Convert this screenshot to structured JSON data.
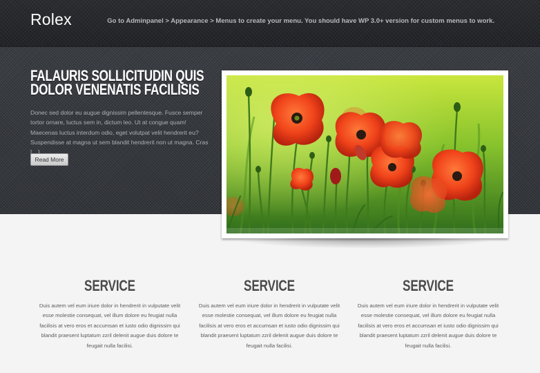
{
  "header": {
    "logo": "Rolex",
    "menu_notice": "Go to Adminpanel > Appearance > Menus to create your menu. You should have WP 3.0+ version for custom menus to work."
  },
  "hero": {
    "title": "Falauris sollicitudin quis dolor venenatis facilisis",
    "excerpt": "Donec sed dolor eu augue dignissim pellentesque. Fusce semper tortor ornare, luctus sem in, dictum leo. Ut at congue quam! Maecenas luctus interdum odio, eget volutpat velit hendrerit eu? Suspendisse at magna ut sem blandit hendrerit non ut magna. Cras […]",
    "read_more_label": "Read More",
    "image_subject": "red poppies in green meadow"
  },
  "services": [
    {
      "title": "Service",
      "text": "Duis autem vel eum iriure dolor in hendrerit in vulputate velit esse molestie consequat, vel illum dolore eu feugiat nulla facilisis at vero eros et accumsan et iusto odio dignissim qui blandit praesent luptatum zzril delenit augue duis dolore te feugait nulla facilisi."
    },
    {
      "title": "Service",
      "text": "Duis autem vel eum iriure dolor in hendrerit in vulputate velit esse molestie consequat, vel illum dolore eu feugiat nulla facilisis at vero eros et accumsan et iusto odio dignissim qui blandit praesent luptatum zzril delenit augue duis dolore te feugait nulla facilisi."
    },
    {
      "title": "Service",
      "text": "Duis autem vel eum iriure dolor in hendrerit in vulputate velit esse molestie consequat, vel illum dolore eu feugiat nulla facilisis at vero eros et accumsan et iusto odio dignissim qui blandit praesent luptatum zzril delenit augue duis dolore te feugait nulla facilisi."
    }
  ],
  "colors": {
    "header_bg": "#26282c",
    "hero_bg": "#383b40",
    "body_bg": "#f4f4f4",
    "heading_dark": "#4a4a4a",
    "poppy_red": "#e23b16",
    "meadow_green": "#6fae2a"
  }
}
